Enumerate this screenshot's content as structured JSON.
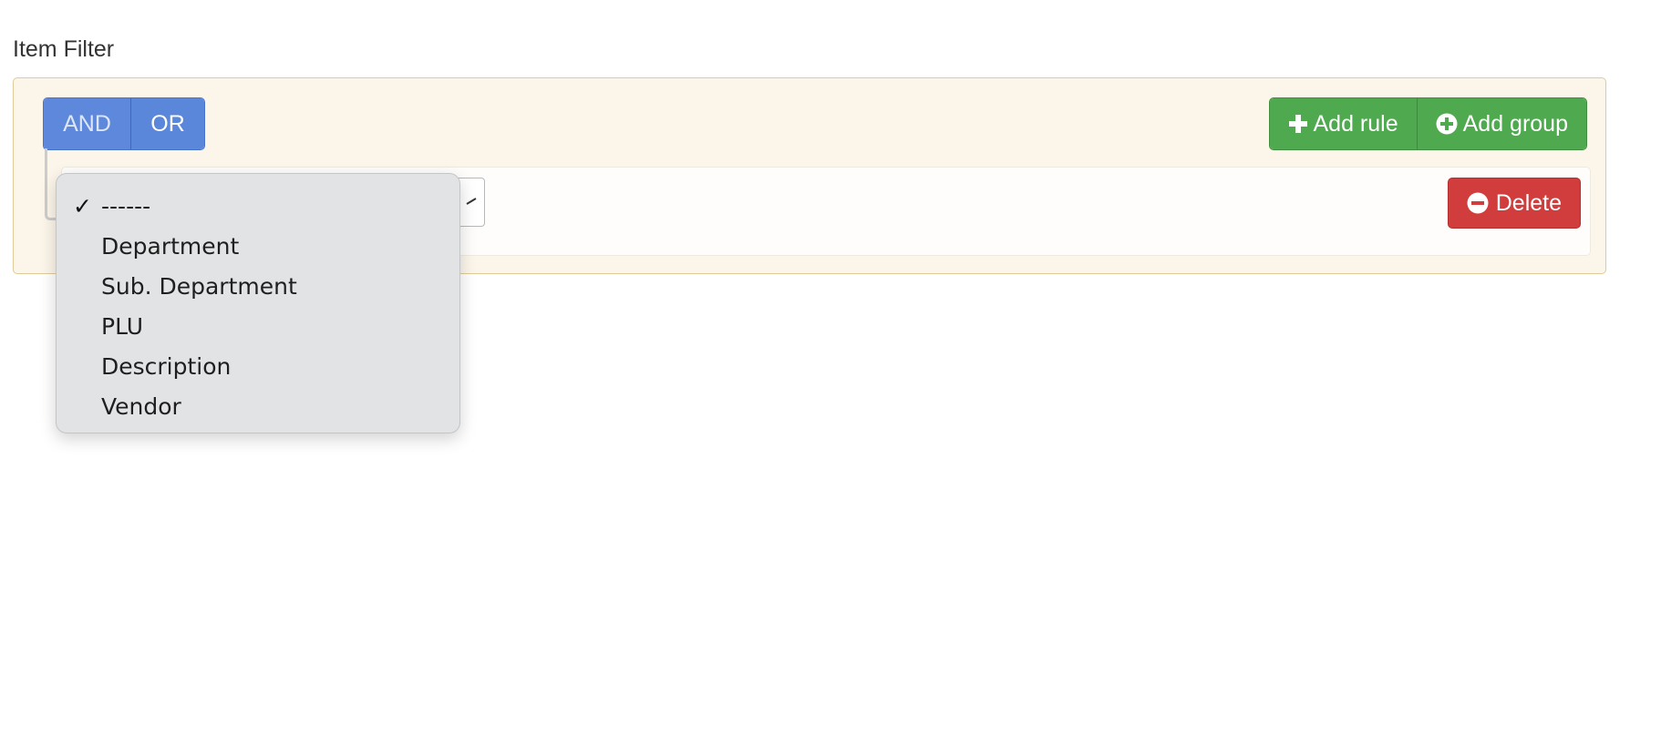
{
  "filter": {
    "title": "Item Filter",
    "conditions": {
      "and_label": "AND",
      "or_label": "OR",
      "selected": "AND"
    },
    "actions": {
      "add_rule_label": "Add rule",
      "add_group_label": "Add group"
    },
    "rule": {
      "delete_label": "Delete"
    },
    "field_dropdown": {
      "selected": "------",
      "options": [
        "------",
        "Department",
        "Sub. Department",
        "PLU",
        "Description",
        "Vendor"
      ]
    }
  },
  "icons": {
    "add_rule": "plus-icon",
    "add_group": "plus-circle-icon",
    "delete": "minus-circle-icon",
    "selected_check": "checkmark-icon"
  },
  "colors": {
    "condition_button": "#5b87da",
    "add_button": "#4fa94f",
    "delete_button": "#d13c3c",
    "group_background": "#fcf6ea",
    "group_border": "#decb99",
    "dropdown_background": "#e2e3e5"
  }
}
